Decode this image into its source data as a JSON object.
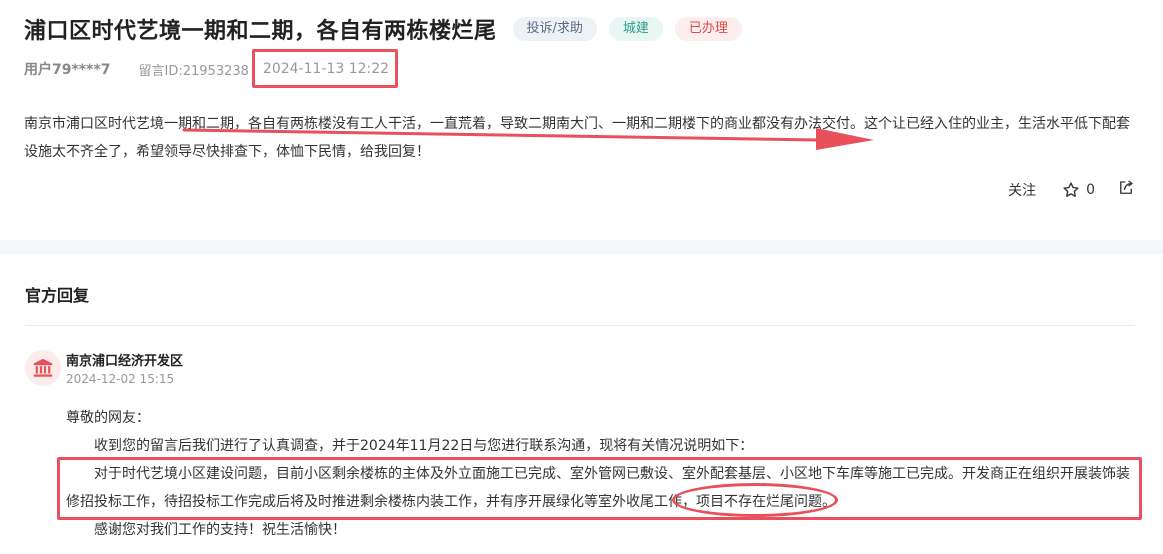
{
  "post": {
    "title": "浦口区时代艺境一期和二期，各自有两栋楼烂尾",
    "tags": [
      {
        "label": "投诉/求助",
        "kind": "type"
      },
      {
        "label": "城建",
        "kind": "category"
      },
      {
        "label": "已办理",
        "kind": "status"
      }
    ],
    "user": "用户79****7",
    "message_id": "留言ID:21953238",
    "timestamp": "2024-11-13 12:22",
    "body": "南京市浦口区时代艺境一期和二期，各自有两栋楼没有工人干活，一直荒着，导致二期南大门、一期和二期楼下的商业都没有办法交付。这个让已经入住的业主，生活水平低下配套设施太不齐全了，希望领导尽快排查下，体恤下民情，给我回复！",
    "actions": {
      "follow_label": "关注",
      "star_count": "0"
    }
  },
  "reply": {
    "section_title": "官方回复",
    "org_name": "南京浦口经济开发区",
    "date": "2024-12-02 15:15",
    "greeting": "尊敬的网友：",
    "para1": "收到您的留言后我们进行了认真调查，并于2024年11月22日与您进行联系沟通，现将有关情况说明如下：",
    "para2": "对于时代艺境小区建设问题，目前小区剩余楼栋的主体及外立面施工已完成、室外管网已敷设、室外配套基层、小区地下车库等施工已完成。开发商正在组织开展装饰装修招投标工作，待招投标工作完成后将及时推进剩余楼栋内装工作，并有序开展绿化等室外收尾工作，项目不存在烂尾问题。",
    "closing": "感谢您对我们工作的支持！祝生活愉快！"
  },
  "colors": {
    "annotation_red": "#e8505b",
    "status_red": "#e04848",
    "category_green": "#2f9d8a"
  },
  "icons": {
    "star": "star-icon",
    "share": "share-icon",
    "org": "government-building-icon"
  }
}
